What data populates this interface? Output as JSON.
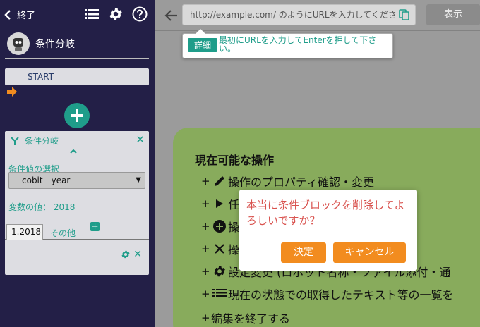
{
  "sidebar": {
    "back_label": "終了",
    "robot_name": "条件分岐",
    "start_label": "START",
    "condition_block": {
      "title": "条件分岐",
      "select_label": "条件値の選択",
      "selected_value": "__cobit__year__",
      "variable_value": "変数の値： 2018",
      "tabs": [
        {
          "label": "1.2018",
          "active": true
        },
        {
          "label": "その他",
          "active": false
        }
      ]
    }
  },
  "topbar": {
    "url_placeholder": "http://example.com/ のようにURLを入力してくださ",
    "show_button": "表示"
  },
  "tooltip": {
    "badge": "詳細",
    "text": "最初にURLを入力してEnterを押して下さい。"
  },
  "panel": {
    "title": "現在可能な操作",
    "operations": [
      {
        "plus": "+",
        "icon": "pencil-icon",
        "label": "操作のプロパティ確認・変更"
      },
      {
        "plus": "+",
        "icon": "play-icon",
        "label": "任"
      },
      {
        "plus": "+",
        "icon": "add-circle-icon",
        "label": "操"
      },
      {
        "plus": "+",
        "icon": "close-icon",
        "label": "操"
      },
      {
        "plus": "+",
        "icon": "gear-icon",
        "label": "設定変更 (ロボット名称・ファイル添付・通"
      },
      {
        "plus": "+",
        "icon": "list-icon",
        "label": "現在の状態での取得したテキスト等の一覧を"
      },
      {
        "plus": "+",
        "icon": "",
        "label": "編集を終了する"
      }
    ]
  },
  "modal": {
    "message": "本当に条件ブロックを削除してよろしいですか？",
    "ok_label": "決定",
    "cancel_label": "キャンセル"
  },
  "colors": {
    "sidebar_bg": "#231f47",
    "accent_teal": "#1f9d8a",
    "panel_green": "#88ab5c",
    "button_orange": "#f28c1f",
    "warning_red": "#d9534f"
  }
}
